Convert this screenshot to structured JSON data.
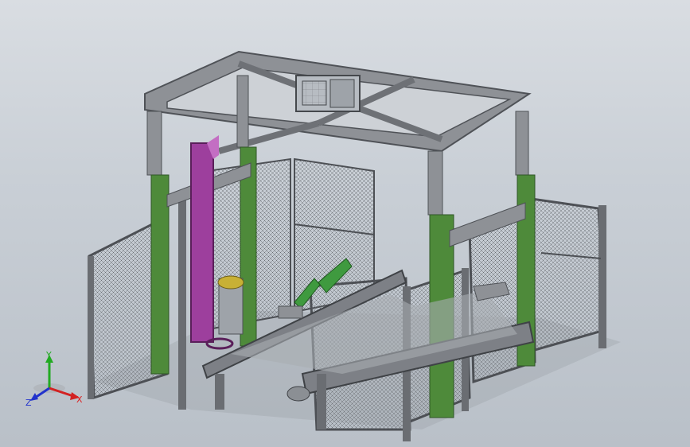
{
  "viewport": {
    "background_top": "#d9dde2",
    "background_bottom": "#b9c0c8"
  },
  "colors": {
    "frame_grey": "#8e9196",
    "frame_dark": "#5a5d62",
    "leg_green": "#4e8a3a",
    "arm_magenta": "#9d3f9d",
    "mesh": "#5f6368",
    "gripper_green": "#3f9a3f",
    "tape_yellow": "#c8b035"
  },
  "triad": {
    "x_label": "X",
    "y_label": "Y",
    "z_label": "Z",
    "x_color": "#d22222",
    "y_color": "#22aa22",
    "z_color": "#2233cc"
  }
}
